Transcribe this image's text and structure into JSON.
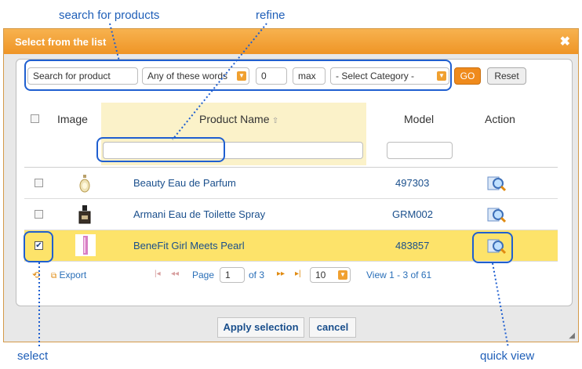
{
  "annotations": {
    "search": "search for products",
    "refine": "refine",
    "select": "select",
    "quick_view": "quick view"
  },
  "dialog": {
    "title": "Select from the list",
    "close_symbol": "✖"
  },
  "search_bar": {
    "search_value": "Search for product",
    "match_mode": "Any of these words",
    "min_value": "0",
    "max_value": "max",
    "category": "- Select Category -",
    "go_label": "GO",
    "reset_label": "Reset"
  },
  "table": {
    "headers": {
      "image": "Image",
      "product_name": "Product Name",
      "model": "Model",
      "action": "Action"
    },
    "rows": [
      {
        "name": "Beauty Eau de Parfum",
        "model": "497303",
        "checked": false
      },
      {
        "name": "Armani Eau de Toilette Spray",
        "model": "GRM002",
        "checked": false
      },
      {
        "name": "BeneFit Girl Meets Pearl",
        "model": "483857",
        "checked": true
      }
    ]
  },
  "pager": {
    "export_label": "Export",
    "page_label": "Page",
    "page_value": "1",
    "of_label": "of 3",
    "rows_per_page": "10",
    "view_label": "View 1 - 3 of 61"
  },
  "footer": {
    "apply_label": "Apply selection",
    "cancel_label": "cancel"
  },
  "colors": {
    "accent": "#f4a23a",
    "selected_row": "#fde36a",
    "sort_column": "#fbf2c9",
    "annotation": "#1f5fd0"
  }
}
